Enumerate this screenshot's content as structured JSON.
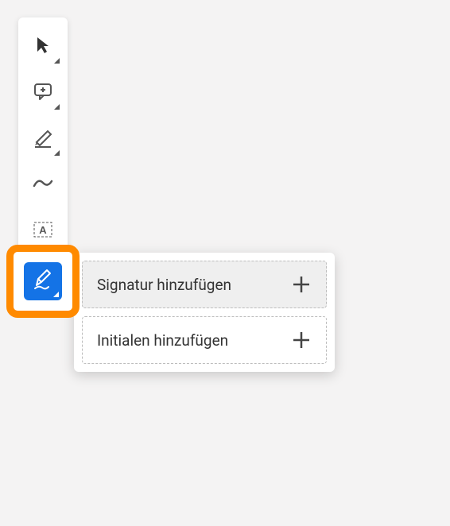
{
  "toolbar": {
    "tools": [
      {
        "name": "select-tool",
        "icon": "cursor-icon"
      },
      {
        "name": "comment-tool",
        "icon": "comment-plus-icon"
      },
      {
        "name": "highlight-tool",
        "icon": "highlighter-icon"
      },
      {
        "name": "draw-tool",
        "icon": "freehand-icon"
      },
      {
        "name": "textbox-tool",
        "icon": "text-box-icon"
      },
      {
        "name": "sign-tool",
        "icon": "pen-sign-icon"
      }
    ]
  },
  "popup": {
    "items": [
      {
        "label": "Signatur hinzufügen",
        "name": "add-signature",
        "hovered": true
      },
      {
        "label": "Initialen hinzufügen",
        "name": "add-initials",
        "hovered": false
      }
    ]
  },
  "colors": {
    "accent": "#ff8a00",
    "primary": "#1473e6"
  }
}
